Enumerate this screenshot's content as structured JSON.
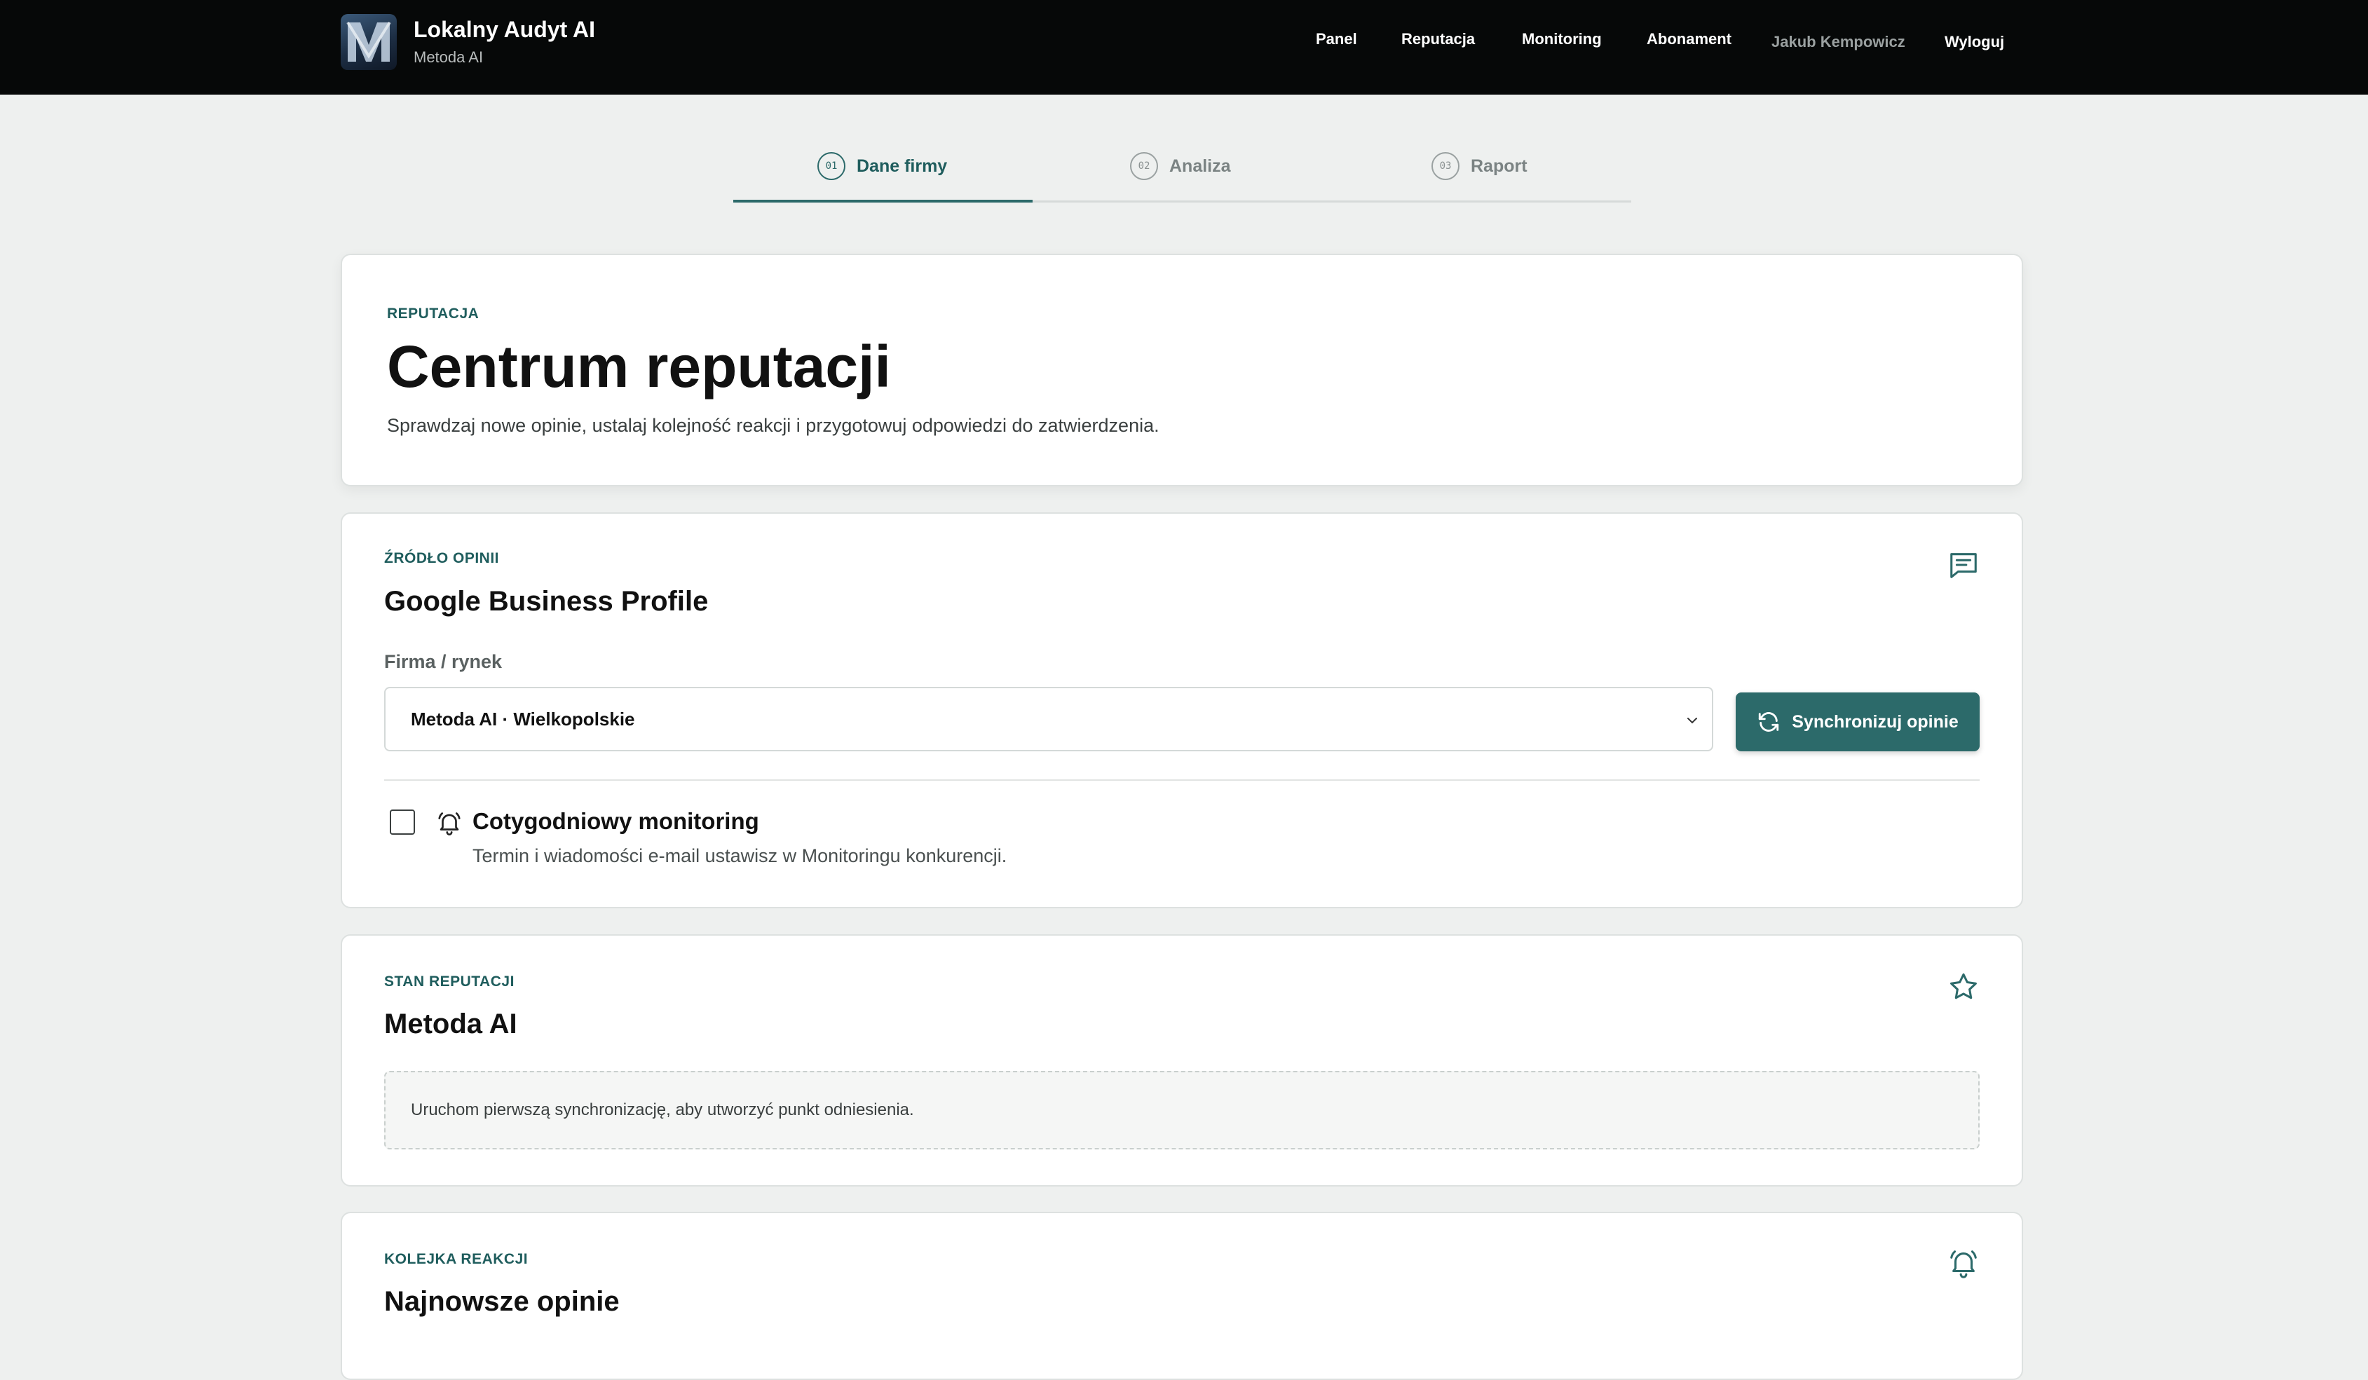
{
  "app": {
    "title": "Lokalny Audyt AI",
    "subtitle": "Metoda AI",
    "logo_icon": "m-letter-logo"
  },
  "nav": {
    "items": [
      {
        "label": "Panel"
      },
      {
        "label": "Reputacja"
      },
      {
        "label": "Monitoring"
      },
      {
        "label": "Abonament"
      }
    ],
    "user": "Jakub Kempowicz",
    "logout": "Wyloguj"
  },
  "stepper": {
    "steps": [
      {
        "num": "01",
        "label": "Dane firmy",
        "active": true
      },
      {
        "num": "02",
        "label": "Analiza",
        "active": false
      },
      {
        "num": "03",
        "label": "Raport",
        "active": false
      }
    ]
  },
  "hero": {
    "eyebrow": "REPUTACJA",
    "title": "Centrum reputacji",
    "description": "Sprawdzaj nowe opinie, ustalaj kolejność reakcji i przygotowuj odpowiedzi do zatwierdzenia."
  },
  "source": {
    "eyebrow": "ŹRÓDŁO OPINII",
    "title": "Google Business Profile",
    "icon": "message-square-icon",
    "field_label": "Firma / rynek",
    "selected": "Metoda AI · Wielkopolskie",
    "sync_button": "Synchronizuj opinie",
    "monitoring": {
      "checked": false,
      "title": "Cotygodniowy monitoring",
      "description": "Termin i wiadomości e-mail ustawisz w Monitoringu konkurencji."
    }
  },
  "state": {
    "eyebrow": "STAN REPUTACJI",
    "title": "Metoda AI",
    "icon": "star-icon",
    "notice": "Uruchom pierwszą synchronizację, aby utworzyć punkt odniesienia."
  },
  "queue": {
    "eyebrow": "KOLEJKA REAKCJI",
    "title": "Najnowsze opinie",
    "icon": "bell-icon"
  },
  "colors": {
    "accent": "#2c6a6a",
    "topbar": "#060808",
    "background": "#eef0ef"
  }
}
